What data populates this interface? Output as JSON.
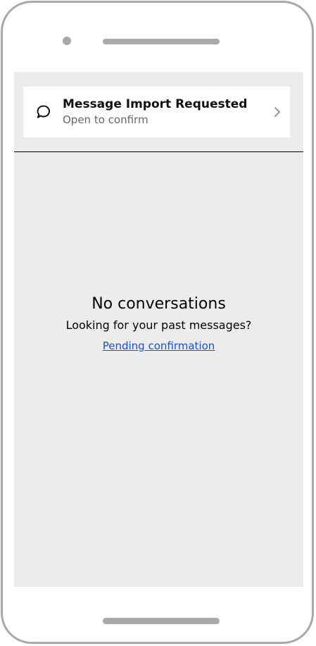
{
  "banner": {
    "icon": "chat-bubble-icon",
    "title": "Message Import Requested",
    "subtitle": "Open to confirm",
    "chevron": "chevron-right-icon"
  },
  "peek_text": "· · ·",
  "empty_state": {
    "title": "No conversations",
    "body": "Looking for your past messages?",
    "link": "Pending confirmation"
  },
  "colors": {
    "screen_background": "#ececec",
    "link": "#1c4fd6",
    "frame": "#a9a9a9"
  }
}
